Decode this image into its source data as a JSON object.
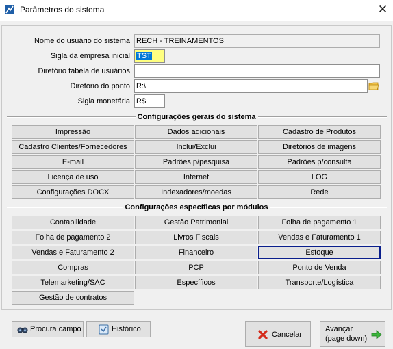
{
  "window": {
    "title": "Parâmetros do sistema",
    "close_glyph": "✕"
  },
  "fields": {
    "usuario": {
      "label": "Nome do usuário do sistema",
      "value": "RECH - TREINAMENTOS"
    },
    "sigla_empresa": {
      "label": "Sigla da empresa inicial",
      "value": "TST"
    },
    "diretorio_usuarios": {
      "label": "Diretório tabela de usuários",
      "value": ""
    },
    "diretorio_ponto": {
      "label": "Diretório do ponto",
      "value": "R:\\"
    },
    "sigla_monetaria": {
      "label": "Sigla monetária",
      "value": "R$"
    }
  },
  "sections": {
    "gerais_title": "Configurações gerais do sistema",
    "especificas_title": "Configurações específicas por módulos"
  },
  "gerais_buttons": [
    "Impressão",
    "Dados adicionais",
    "Cadastro de Produtos",
    "Cadastro Clientes/Fornecedores",
    "Inclui/Exclui",
    "Diretórios de imagens",
    "E-mail",
    "Padrões p/pesquisa",
    "Padrões p/consulta",
    "Licença de uso",
    "Internet",
    "LOG",
    "Configurações DOCX",
    "Indexadores/moedas",
    "Rede"
  ],
  "especificas_buttons": [
    "Contabilidade",
    "Gestão Patrimonial",
    "Folha de pagamento 1",
    "Folha de pagamento 2",
    "Livros Fiscais",
    "Vendas e Faturamento 1",
    "Vendas e Faturamento 2",
    "Financeiro",
    "Estoque",
    "Compras",
    "PCP",
    "Ponto de Venda",
    "Telemarketing/SAC",
    "Específicos",
    "Transporte/Logística",
    "Gestão de contratos"
  ],
  "focused_button": "Estoque",
  "footer": {
    "procura": "Procura campo",
    "historico": "Histórico",
    "cancelar": "Cancelar",
    "avancar_line1": "Avançar",
    "avancar_line2": "(page down)"
  },
  "icons": {
    "app": "app-icon",
    "folder": "folder-icon",
    "procura": "binoculars-icon",
    "historico": "history-icon",
    "cancelar": "red-x-icon",
    "avancar": "green-arrow-right-icon"
  },
  "colors": {
    "window_bg": "#f0f0f0",
    "button_face": "#e1e1e1",
    "focus_border": "#0a1e8c",
    "selection": "#0078d7",
    "highlight_field": "#ffff80"
  }
}
